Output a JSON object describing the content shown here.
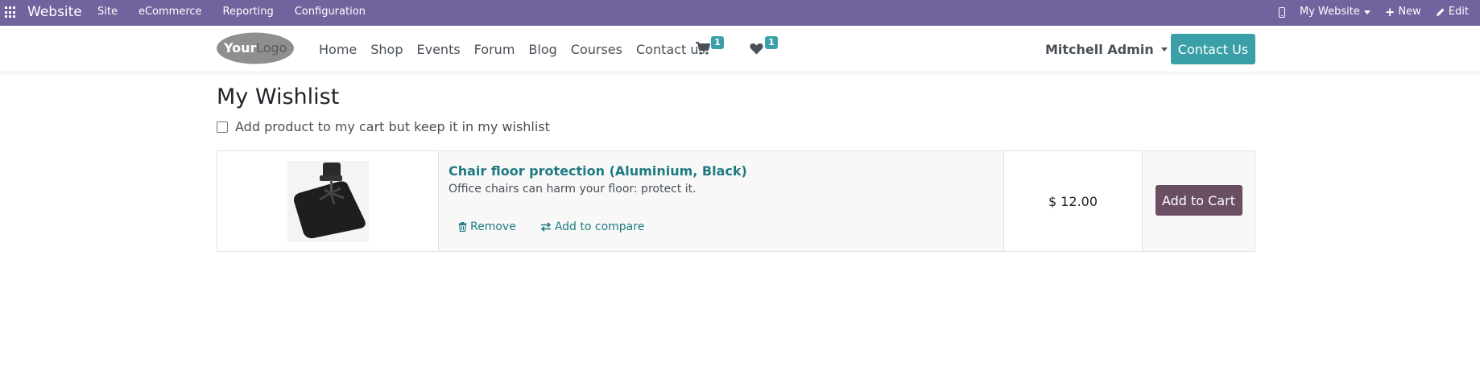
{
  "topbar": {
    "brand": "Website",
    "menu": [
      "Site",
      "eCommerce",
      "Reporting",
      "Configuration"
    ],
    "my_website": "My Website",
    "new": "New",
    "edit": "Edit"
  },
  "header": {
    "logo": "YourLogo",
    "nav": [
      "Home",
      "Shop",
      "Events",
      "Forum",
      "Blog",
      "Courses",
      "Contact us"
    ],
    "cart_count": "1",
    "wishlist_count": "1",
    "user": "Mitchell Admin",
    "contact_button": "Contact Us"
  },
  "page": {
    "title": "My Wishlist",
    "keep_in_wishlist": "Add product to my cart but keep it in my wishlist"
  },
  "wishlist": [
    {
      "name": "Chair floor protection (Aluminium, Black)",
      "description": "Office chairs can harm your floor: protect it.",
      "remove": "Remove",
      "compare": "Add to compare",
      "price": "$ 12.00",
      "add_to_cart": "Add to Cart"
    }
  ],
  "colors": {
    "admin_bar": "#71639e",
    "primary": "#3a9fa7",
    "secondary": "#6a4f62",
    "link": "#1f7a82"
  }
}
